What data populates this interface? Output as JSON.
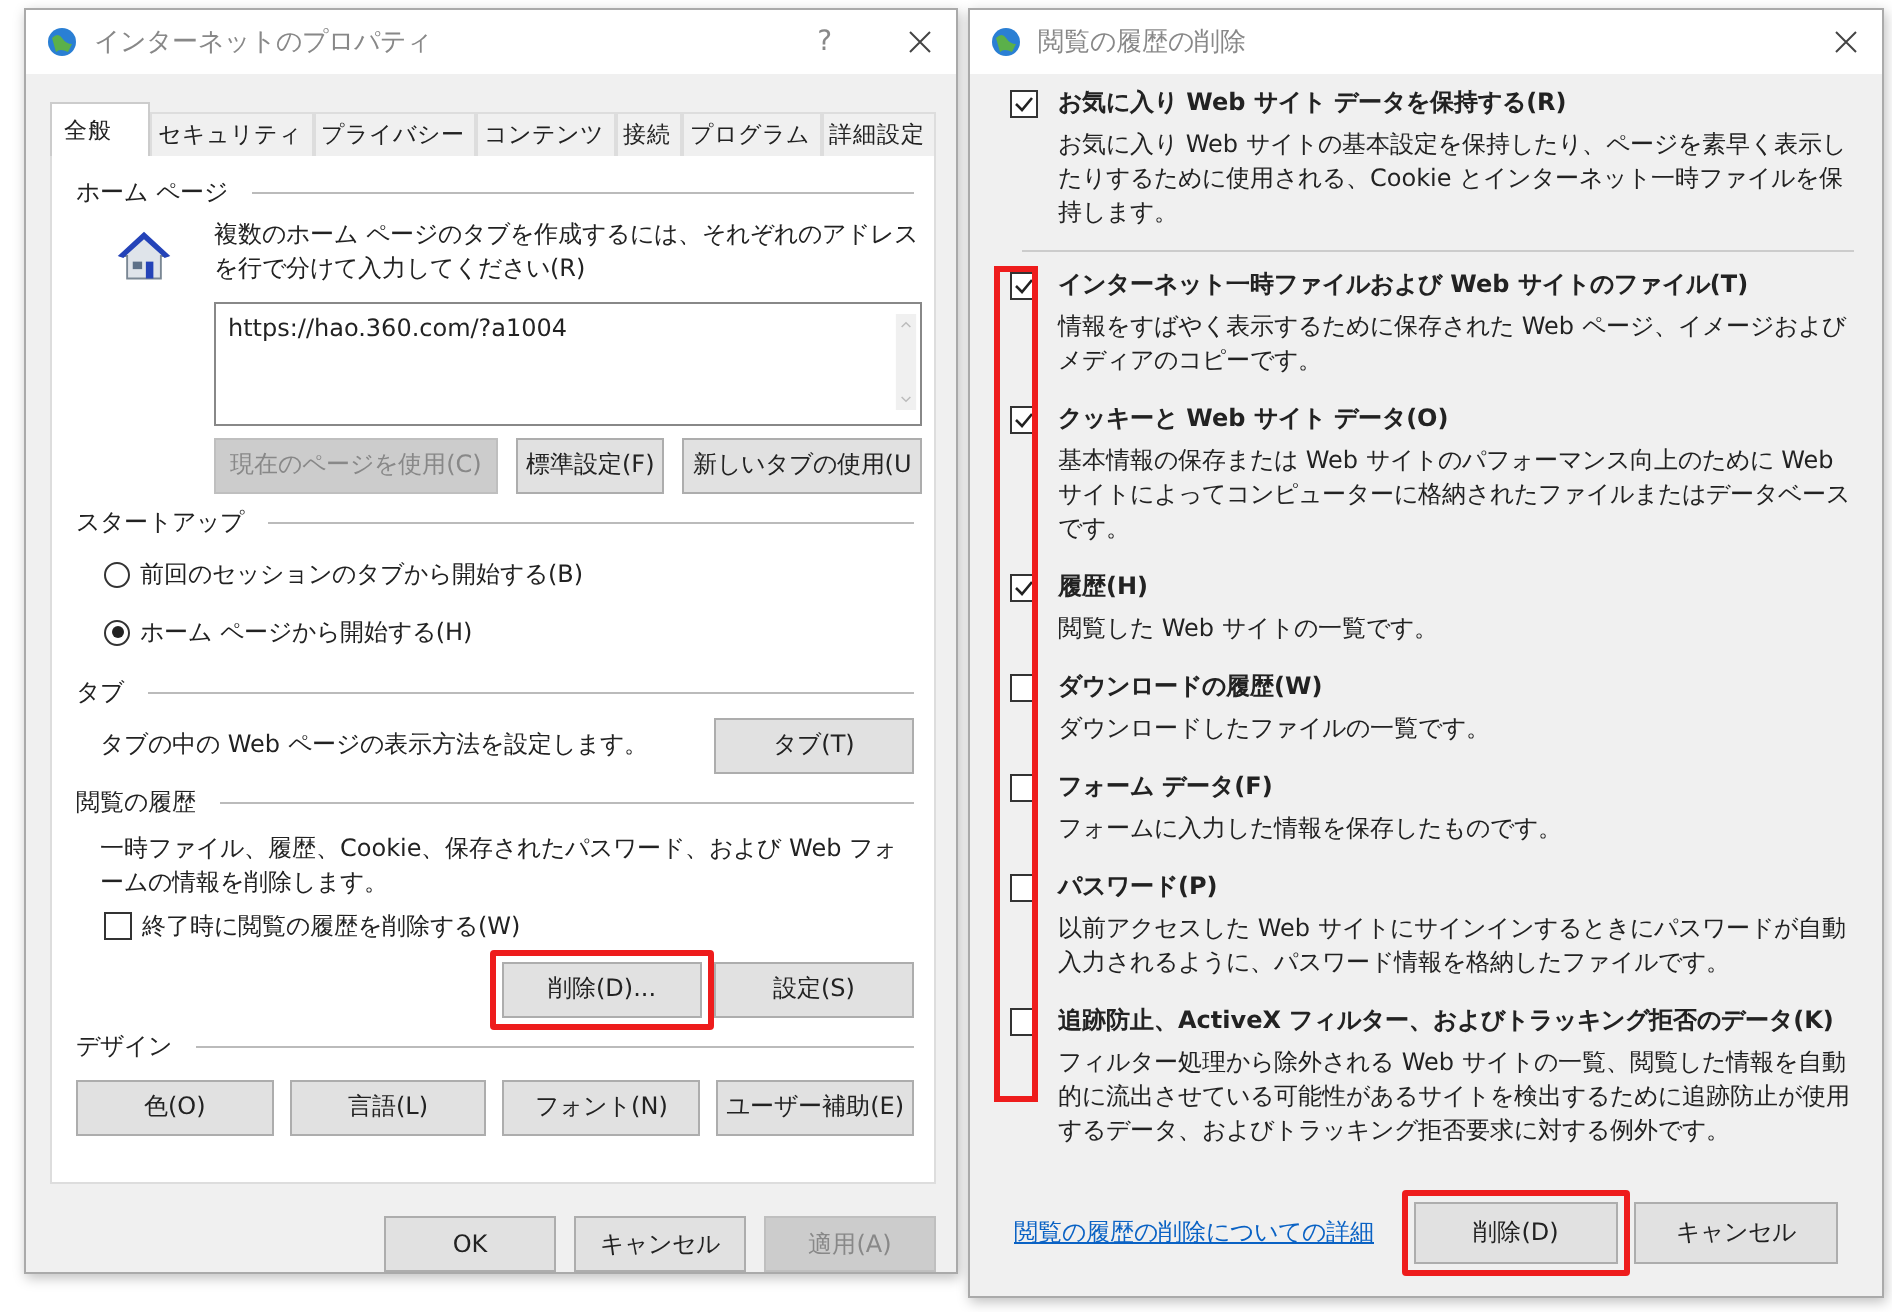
{
  "properties_window": {
    "title": "インターネットのプロパティ",
    "help": "?",
    "tabs": [
      {
        "label": "全般",
        "selected": true
      },
      {
        "label": "セキュリティ",
        "selected": false
      },
      {
        "label": "プライバシー",
        "selected": false
      },
      {
        "label": "コンテンツ",
        "selected": false
      },
      {
        "label": "接続",
        "selected": false
      },
      {
        "label": "プログラム",
        "selected": false
      },
      {
        "label": "詳細設定",
        "selected": false
      }
    ],
    "home_page": {
      "title": "ホーム ページ",
      "description": "複数のホーム ページのタブを作成するには、それぞれのアドレスを行で分けて入力してください(R)",
      "value": "https://hao.360.com/?a1004",
      "buttons": [
        {
          "label": "現在のページを使用(C)",
          "disabled": true
        },
        {
          "label": "標準設定(F)",
          "disabled": false
        },
        {
          "label": "新しいタブの使用(U",
          "disabled": false
        }
      ]
    },
    "startup": {
      "title": "スタートアップ",
      "options": [
        {
          "label": "前回のセッションのタブから開始する(B)",
          "selected": false
        },
        {
          "label": "ホーム ページから開始する(H)",
          "selected": true
        }
      ]
    },
    "tabs_section": {
      "title": "タブ",
      "description": "タブの中の Web ページの表示方法を設定します。",
      "button": "タブ(T)"
    },
    "history": {
      "title": "閲覧の履歴",
      "description": "一時ファイル、履歴、Cookie、保存されたパスワード、および Web フォームの情報を削除します。",
      "checkbox": {
        "label": "終了時に閲覧の履歴を削除する(W)",
        "checked": false
      },
      "buttons": [
        {
          "label": "削除(D)...",
          "highlighted": true
        },
        {
          "label": "設定(S)",
          "highlighted": false
        }
      ]
    },
    "design": {
      "title": "デザイン",
      "buttons": [
        "色(O)",
        "言語(L)",
        "フォント(N)",
        "ユーザー補助(E)"
      ]
    },
    "footer_buttons": [
      {
        "label": "OK",
        "disabled": false
      },
      {
        "label": "キャンセル",
        "disabled": false
      },
      {
        "label": "適用(A)",
        "disabled": true
      }
    ]
  },
  "delete_history_window": {
    "title": "閲覧の履歴の削除",
    "checkbox_column_highlighted": true,
    "options": [
      {
        "label": "お気に入り Web サイト データを保持する(R)",
        "checked": true,
        "description": "お気に入り Web サイトの基本設定を保持したり、ページを素早く表示したりするために使用される、Cookie とインターネット一時ファイルを保持します。"
      },
      {
        "label": "インターネット一時ファイルおよび Web サイトのファイル(T)",
        "checked": true,
        "description": "情報をすばやく表示するために保存された Web ページ、イメージおよびメディアのコピーです。"
      },
      {
        "label": "クッキーと Web サイト データ(O)",
        "checked": true,
        "description": "基本情報の保存または Web サイトのパフォーマンス向上のために Web サイトによってコンピューターに格納されたファイルまたはデータベースです。"
      },
      {
        "label": "履歴(H)",
        "checked": true,
        "description": "閲覧した Web サイトの一覧です。"
      },
      {
        "label": "ダウンロードの履歴(W)",
        "checked": false,
        "description": "ダウンロードしたファイルの一覧です。"
      },
      {
        "label": "フォーム データ(F)",
        "checked": false,
        "description": "フォームに入力した情報を保存したものです。"
      },
      {
        "label": "パスワード(P)",
        "checked": false,
        "description": "以前アクセスした Web サイトにサインインするときにパスワードが自動入力されるように、パスワード情報を格納したファイルです。"
      },
      {
        "label": "追跡防止、ActiveX フィルター、およびトラッキング拒否のデータ(K)",
        "checked": false,
        "description": "フィルター処理から除外される Web サイトの一覧、閲覧した情報を自動的に流出させている可能性があるサイトを検出するために追跡防止が使用するデータ、およびトラッキング拒否要求に対する例外です。"
      }
    ],
    "link": "閲覧の履歴の削除についての詳細",
    "buttons": [
      {
        "label": "削除(D)",
        "highlighted": true
      },
      {
        "label": "キャンセル",
        "highlighted": false
      }
    ]
  }
}
